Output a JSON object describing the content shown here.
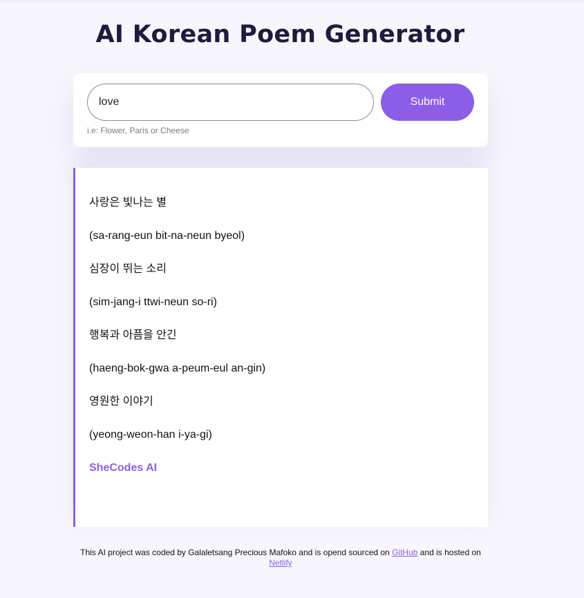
{
  "header": {
    "title": "AI Korean Poem Generator"
  },
  "form": {
    "input_value": "love",
    "submit_label": "Submit",
    "hint": "i.e: Flower, Paris or Cheese"
  },
  "poem": {
    "lines": [
      "사랑은 빛나는 별",
      "(sa-rang-eun bit-na-neun byeol)",
      "심장이 뛰는 소리",
      "(sim-jang-i ttwi-neun so-ri)",
      "행복과 아픔을 안긴",
      "(haeng-bok-gwa a-peum-eul an-gin)",
      "영원한 이야기",
      "(yeong-weon-han i-ya-gi)"
    ],
    "signature": "SheCodes AI"
  },
  "footer": {
    "text_before": "This AI project was coded by Galaletsang Precious Mafoko and is opend sourced on ",
    "github_link": "GitHub",
    "text_middle": " and is hosted on ",
    "netlify_link": "Netlify"
  },
  "colors": {
    "accent": "#8c5ee8",
    "title": "#1e1b3e",
    "background": "#f7f6fc"
  }
}
